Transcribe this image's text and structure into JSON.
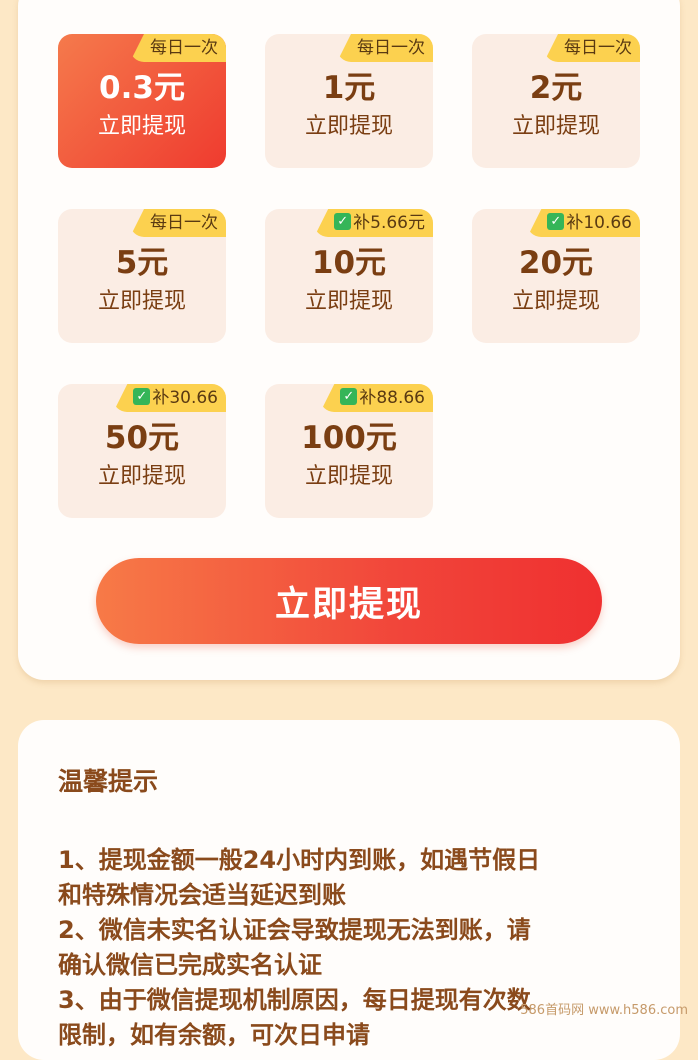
{
  "options": [
    {
      "badge": "每日一次",
      "check": false,
      "amount": "0.3元",
      "label": "立即提现",
      "selected": true
    },
    {
      "badge": "每日一次",
      "check": false,
      "amount": "1元",
      "label": "立即提现",
      "selected": false
    },
    {
      "badge": "每日一次",
      "check": false,
      "amount": "2元",
      "label": "立即提现",
      "selected": false
    },
    {
      "badge": "每日一次",
      "check": false,
      "amount": "5元",
      "label": "立即提现",
      "selected": false
    },
    {
      "badge": "补5.66元",
      "check": true,
      "amount": "10元",
      "label": "立即提现",
      "selected": false
    },
    {
      "badge": "补10.66",
      "check": true,
      "amount": "20元",
      "label": "立即提现",
      "selected": false
    },
    {
      "badge": "补30.66",
      "check": true,
      "amount": "50元",
      "label": "立即提现",
      "selected": false
    },
    {
      "badge": "补88.66",
      "check": true,
      "amount": "100元",
      "label": "立即提现",
      "selected": false
    }
  ],
  "withdraw_button": "立即提现",
  "tips": {
    "title": "温馨提示",
    "lines": [
      "1、提现金额一般24小时内到账，如遇节假日",
      "和特殊情况会适当延迟到账",
      "2、微信未实名认证会导致提现无法到账，请",
      "确认微信已完成实名认证",
      "3、由于微信提现机制原因，每日提现有次数",
      "限制，如有余额，可次日申请"
    ]
  },
  "watermark": "586首码网 www.h586.com",
  "colors": {
    "page_bg": "#fde8c6",
    "selected_tile_start": "#f57a4c",
    "selected_tile_end": "#ef3b2f",
    "tile_bg": "#fbede4",
    "badge_bg": "#fcd14f",
    "text_brown": "#7a3e12"
  }
}
